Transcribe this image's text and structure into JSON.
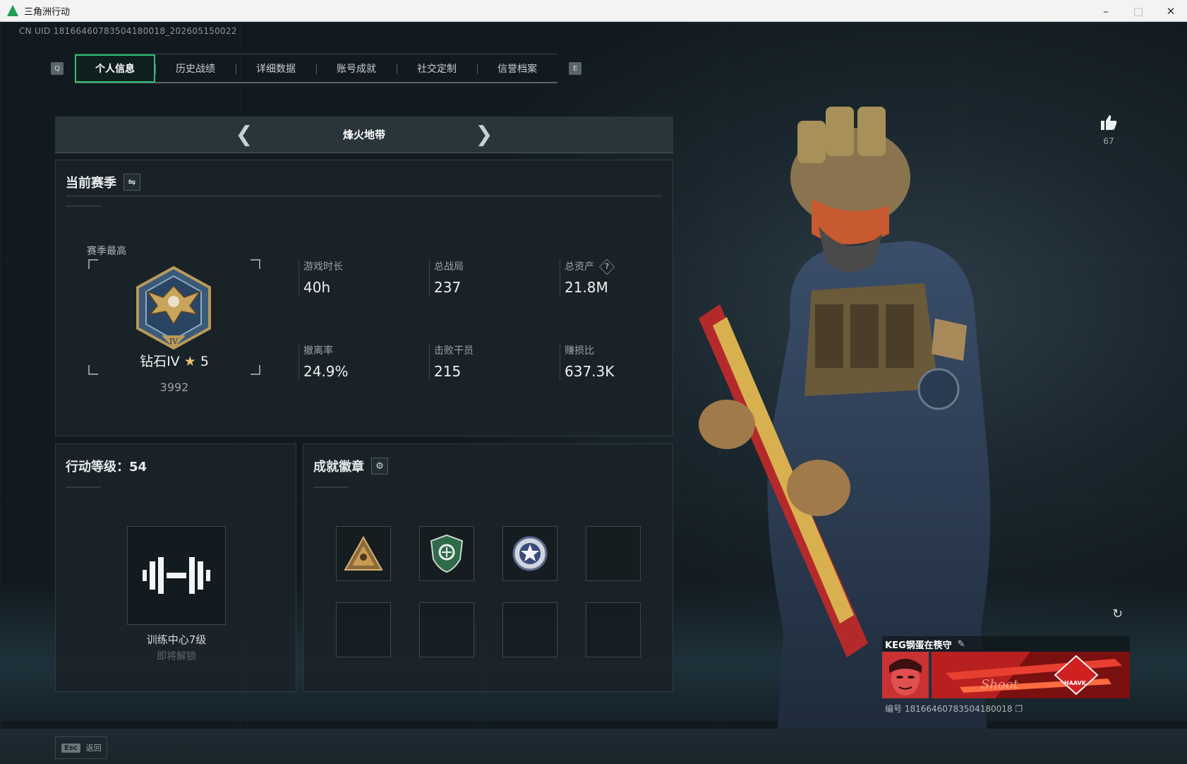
{
  "window": {
    "title": "三角洲行动"
  },
  "game": {
    "uid_text": "CN UID 18166460783504180018_202605150022"
  },
  "tabs": {
    "left_key": "Q",
    "right_key": "E",
    "items": [
      {
        "label": "个人信息",
        "active": true
      },
      {
        "label": "历史战绩",
        "active": false
      },
      {
        "label": "详细数据",
        "active": false
      },
      {
        "label": "账号成就",
        "active": false
      },
      {
        "label": "社交定制",
        "active": false
      },
      {
        "label": "信誉档案",
        "active": false
      }
    ]
  },
  "season_selector": {
    "mode": "烽火地带"
  },
  "current_season": {
    "title": "当前赛季",
    "best_label": "赛季最高",
    "rank_name": "钻石IV",
    "rank_stars": "5",
    "rank_score": "3992",
    "stats": [
      {
        "label": "游戏时长",
        "value": "40h"
      },
      {
        "label": "总战局",
        "value": "237"
      },
      {
        "label": "总资产",
        "value": "21.8M"
      },
      {
        "label": "撤离率",
        "value": "24.9%"
      },
      {
        "label": "击败干员",
        "value": "215"
      },
      {
        "label": "赚损比",
        "value": "637.3K"
      }
    ]
  },
  "level": {
    "title": "行动等级：54",
    "badge_name": "训练中心7级",
    "badge_status": "即将解锁"
  },
  "achievements": {
    "title": "成就徽章"
  },
  "profile": {
    "likes": "67",
    "player_name": "KEG钢蛋在筷守",
    "player_id": "编号 18166460783504180018",
    "banner_text": "Shoot",
    "banner_brand": "HAAVK"
  },
  "footer": {
    "esc_key": "Esc",
    "esc_label": "返回"
  }
}
